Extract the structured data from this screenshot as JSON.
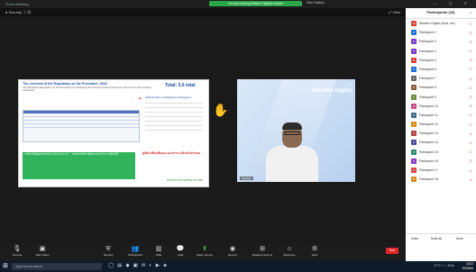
{
  "window": {
    "app_title": "Zoom Meeting",
    "share_banner": "You are viewing Western Digital's screen",
    "view_options": "View Options",
    "controls": "— ▢ ✕"
  },
  "top_strip": {
    "left": "● Security ⓘ ▦",
    "right": "⤢ View"
  },
  "slide": {
    "title": "The overview of the Regulation on the Procedure, 2018",
    "subtitle": "The Ministerial Regulation on the Procedure for Assessing the Amount of Personal Income Tax for Non-Tax resident Individuals",
    "badge": "Total: 5.5 total",
    "green_text": "ภาษีเงินได้บุคคลธรรมดา ตามแบบ ภ.ง.ด. ... หลักเกณฑ์การยื่นแบบและชำระภาษีเงินได้ ...",
    "red_text": "ผู้เสียภาษีต้องยื่นแบบ และชำระภาษีภายในกำหนด",
    "side_table_title": "Total Number of Registered Taxpayers",
    "footer": "ฝ่ายวิเคราะห์ กรมสรรพากร 2563"
  },
  "video": {
    "brand": "Western Digital",
    "brand_small": "WD",
    "name_tag": "Speaker"
  },
  "participants": {
    "title": "Participants (18)",
    "rows": [
      {
        "name": "Western Digital (Host, me)",
        "color": "#d9413f",
        "initial": "W"
      },
      {
        "name": "Participant 2",
        "color": "#1d6fd9",
        "initial": "P"
      },
      {
        "name": "Participant 3",
        "color": "#7a3fc9",
        "initial": "P"
      },
      {
        "name": "Participant 4",
        "color": "#7a3fc9",
        "initial": "P"
      },
      {
        "name": "Participant 5",
        "color": "#d9413f",
        "initial": "P"
      },
      {
        "name": "Participant 6",
        "color": "#1d6fd9",
        "initial": "P"
      },
      {
        "name": "Participant 7",
        "color": "#666666",
        "initial": "P"
      },
      {
        "name": "Participant 8",
        "color": "#8a5a3a",
        "initial": "P"
      },
      {
        "name": "Participant 9",
        "color": "#6a8a3a",
        "initial": "P"
      },
      {
        "name": "Participant 10",
        "color": "#c94a8a",
        "initial": "P"
      },
      {
        "name": "Participant 11",
        "color": "#3a6a8a",
        "initial": "P"
      },
      {
        "name": "Participant 12",
        "color": "#d98a1d",
        "initial": "P"
      },
      {
        "name": "Participant 13",
        "color": "#b04040",
        "initial": "P"
      },
      {
        "name": "Participant 14",
        "color": "#4a4a9a",
        "initial": "P"
      },
      {
        "name": "Participant 15",
        "color": "#2a8a6a",
        "initial": "P"
      },
      {
        "name": "Participant 16",
        "color": "#8a3ac9",
        "initial": "P"
      },
      {
        "name": "Participant 17",
        "color": "#d9413f",
        "initial": "P"
      },
      {
        "name": "Participant 18",
        "color": "#d98a1d",
        "initial": "P"
      }
    ],
    "footer_invite": "Invite",
    "footer_mute": "Mute All",
    "footer_more": "More"
  },
  "toolbar": {
    "unmute": "Unmute",
    "stop_video": "Start Video",
    "security": "Security",
    "participants": "Participants",
    "polls": "Polls",
    "chat": "Chat",
    "share": "Share Screen",
    "record": "Record",
    "breakout": "Breakout Rooms",
    "reactions": "Reactions",
    "apps": "Apps",
    "end": "End"
  },
  "taskbar": {
    "search_placeholder": "Type here to search",
    "tray": "27°C  ^  ◐  ♪  ENG",
    "time": "18:10",
    "date": "2/9/2564"
  }
}
